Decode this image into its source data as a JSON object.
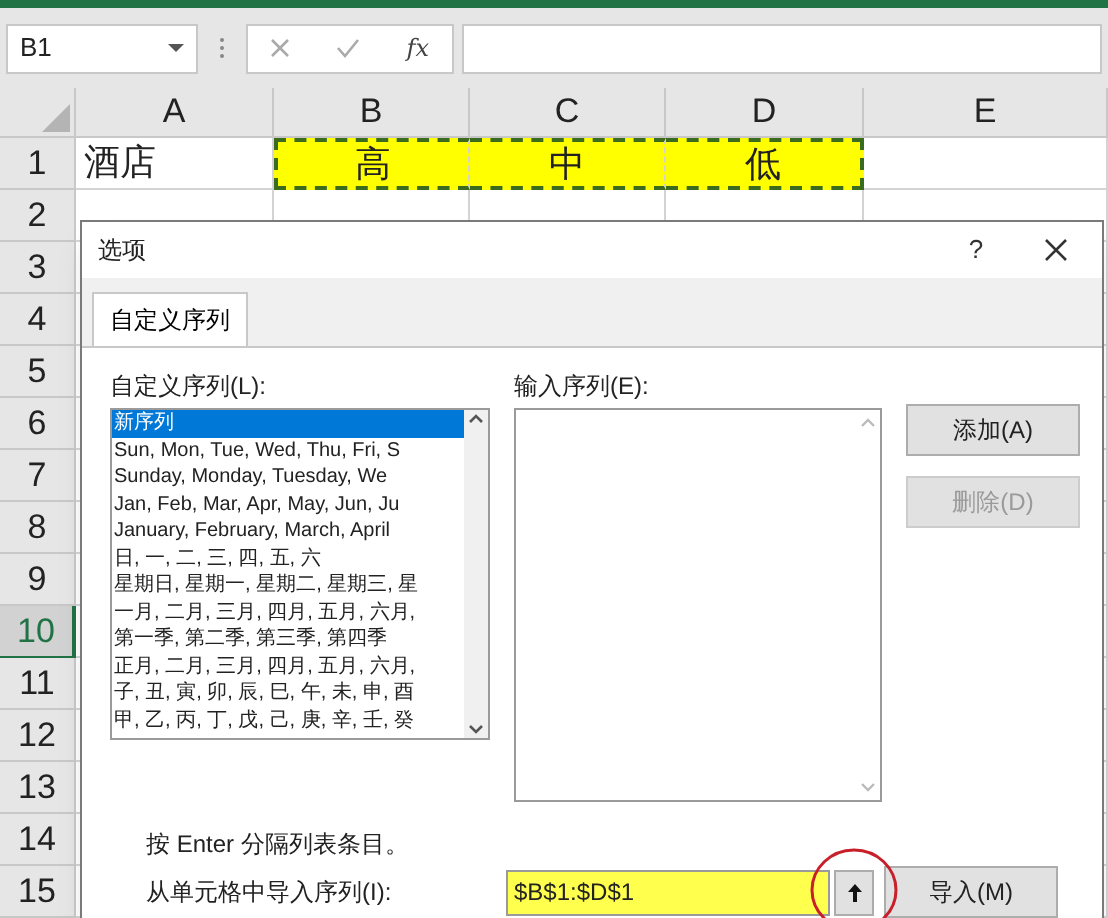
{
  "formula_bar": {
    "name_box": "B1",
    "function_label": "fx"
  },
  "columns": [
    "A",
    "B",
    "C",
    "D",
    "E"
  ],
  "rows": [
    {
      "label": "1",
      "selected": false,
      "cells": [
        {
          "text": "酒店",
          "copied": false
        },
        {
          "text": "高",
          "copied": true,
          "color": "#ffff00"
        },
        {
          "text": "中",
          "copied": true,
          "color": "#ffff00"
        },
        {
          "text": "低",
          "copied": true,
          "color": "#ffff00"
        }
      ]
    },
    {
      "label": "2",
      "selected": false
    },
    {
      "label": "3",
      "selected": false
    },
    {
      "label": "4",
      "selected": false
    },
    {
      "label": "5",
      "selected": false
    },
    {
      "label": "6",
      "selected": false
    },
    {
      "label": "7",
      "selected": false
    },
    {
      "label": "8",
      "selected": false
    },
    {
      "label": "9",
      "selected": false
    },
    {
      "label": "10",
      "selected": true
    },
    {
      "label": "11",
      "selected": false
    },
    {
      "label": "12",
      "selected": false
    },
    {
      "label": "13",
      "selected": false
    },
    {
      "label": "14",
      "selected": false
    },
    {
      "label": "15",
      "selected": false
    }
  ],
  "dialog": {
    "title": "选项",
    "help": "?",
    "tabs": [
      {
        "label": "自定义序列",
        "selected": true
      }
    ],
    "list_label": "自定义序列(L):",
    "list_items": [
      {
        "text": "新序列",
        "selected": true
      },
      {
        "text": "Sun, Mon, Tue, Wed, Thu, Fri, S",
        "selected": false
      },
      {
        "text": "Sunday, Monday, Tuesday, We",
        "selected": false
      },
      {
        "text": "Jan, Feb, Mar, Apr, May, Jun, Ju",
        "selected": false
      },
      {
        "text": "January, February, March, April",
        "selected": false
      },
      {
        "text": "日, 一, 二, 三, 四, 五, 六",
        "selected": false
      },
      {
        "text": "星期日, 星期一, 星期二, 星期三, 星",
        "selected": false
      },
      {
        "text": "一月, 二月, 三月, 四月, 五月, 六月,",
        "selected": false
      },
      {
        "text": "第一季, 第二季, 第三季, 第四季",
        "selected": false
      },
      {
        "text": "正月, 二月, 三月, 四月, 五月, 六月,",
        "selected": false
      },
      {
        "text": "子, 丑, 寅, 卯, 辰, 巳, 午, 未, 申, 酉",
        "selected": false
      },
      {
        "text": "甲, 乙, 丙, 丁, 戊, 己, 庚, 辛, 壬, 癸",
        "selected": false
      }
    ],
    "entry_label": "输入序列(E):",
    "buttons": [
      {
        "label": "添加(A)",
        "disabled": false
      },
      {
        "label": "删除(D)",
        "disabled": true
      }
    ],
    "hint": "按 Enter 分隔列表条目。",
    "import_label": "从单元格中导入序列(I):",
    "import_value": "$B$1:$D$1",
    "import_button": "导入(M)"
  }
}
